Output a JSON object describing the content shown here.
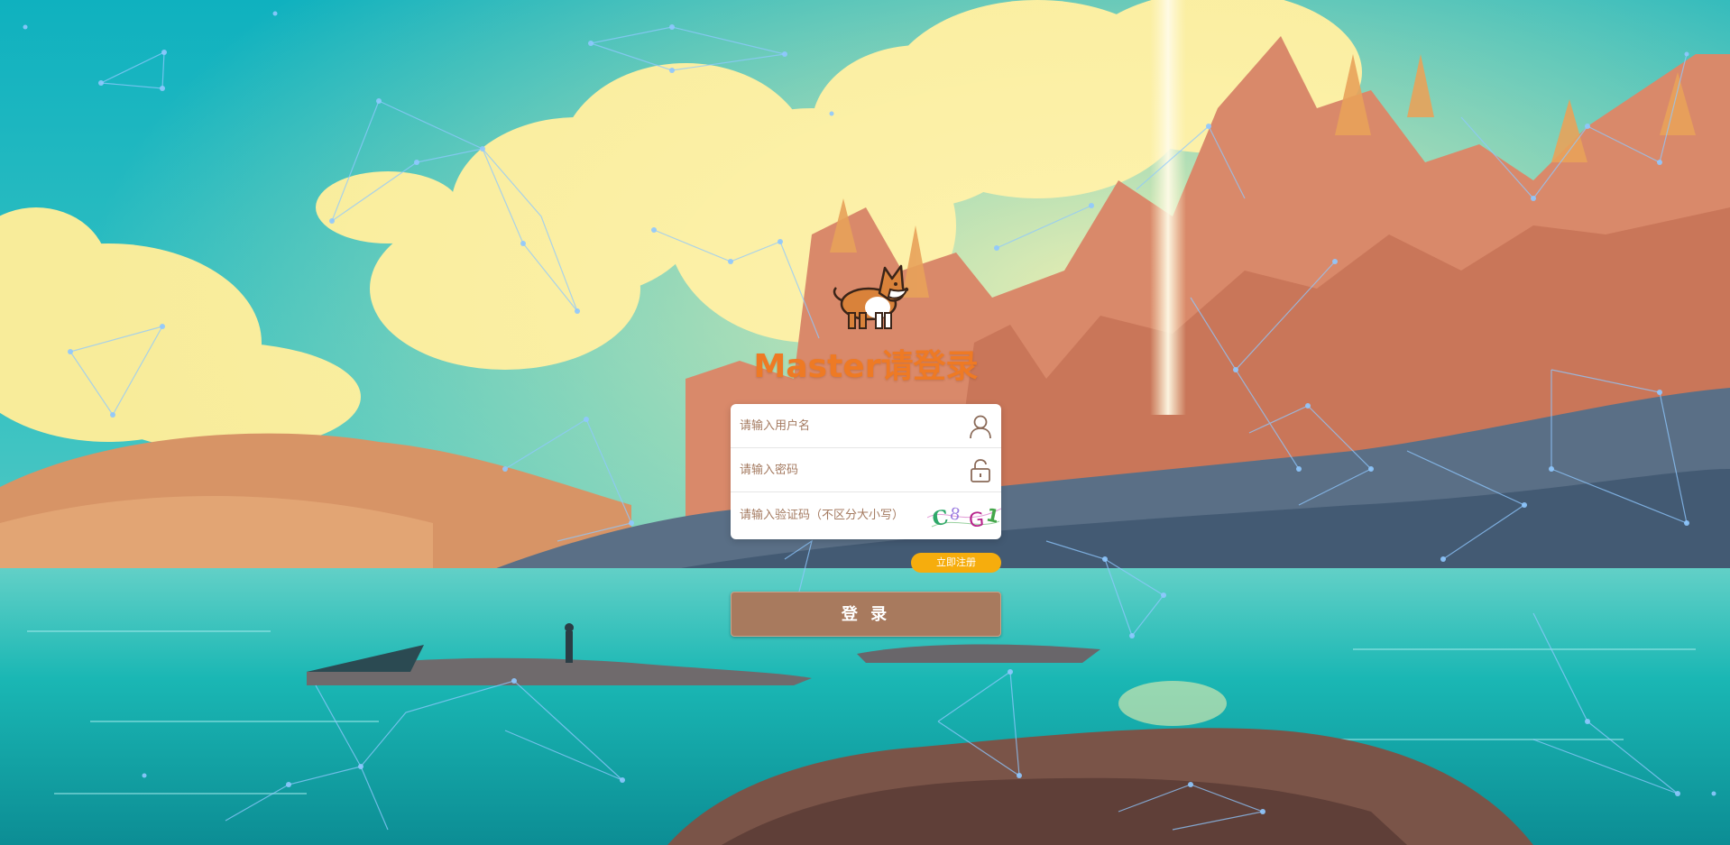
{
  "login": {
    "title": "Master请登录",
    "username_placeholder": "请输入用户名",
    "password_placeholder": "请输入密码",
    "captcha_placeholder": "请输入验证码（不区分大小写）",
    "captcha_text": "C8G1",
    "register_label": "立即注册",
    "submit_label": "登 录"
  },
  "icons": {
    "mascot": "corgi-dog",
    "user": "user-icon",
    "lock": "unlock-icon"
  },
  "colors": {
    "title": "#ee7a24",
    "register": "#f6ad0d",
    "submit": "#a87a5e",
    "placeholder": "#a47a60"
  }
}
